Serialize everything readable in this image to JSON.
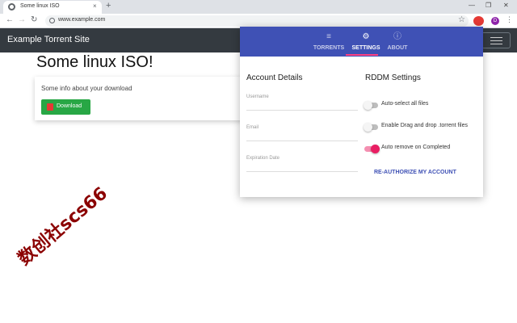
{
  "browser": {
    "tab_title": "Some linux ISO",
    "tab_close": "×",
    "new_tab": "+",
    "win_min": "—",
    "win_restore": "❐",
    "win_close": "✕",
    "back": "←",
    "forward": "→",
    "reload": "↻",
    "url": "www.example.com",
    "star": "☆",
    "avatar_letter": "D",
    "menu": "⋮"
  },
  "site": {
    "brand": "Example Torrent Site",
    "heading": "Some linux ISO!",
    "card_text": "Some info about your download",
    "download_label": "Download"
  },
  "popup": {
    "accent_color": "#3f51b5",
    "tabs": [
      {
        "icon": "≡",
        "label": "TORRENTS",
        "icon_name": "list-icon"
      },
      {
        "icon": "⚙",
        "label": "SETTINGS",
        "icon_name": "gear-icon"
      },
      {
        "icon": "ⓘ",
        "label": "ABOUT",
        "icon_name": "info-icon"
      }
    ],
    "active_tab": "SETTINGS",
    "account_title": "Account Details",
    "fields": [
      {
        "label": "Username"
      },
      {
        "label": "Email"
      },
      {
        "label": "Expiration Date"
      }
    ],
    "rddm_title": "RDDM Settings",
    "toggles": [
      {
        "label": "Auto-select all files",
        "on": false
      },
      {
        "label": "Enable Drag and drop .torrent files",
        "on": false
      },
      {
        "label": "Auto remove on Completed",
        "on": true
      }
    ],
    "reauth_label": "RE-AUTHORIZE MY ACCOUNT"
  },
  "watermark": "数创社scs66"
}
